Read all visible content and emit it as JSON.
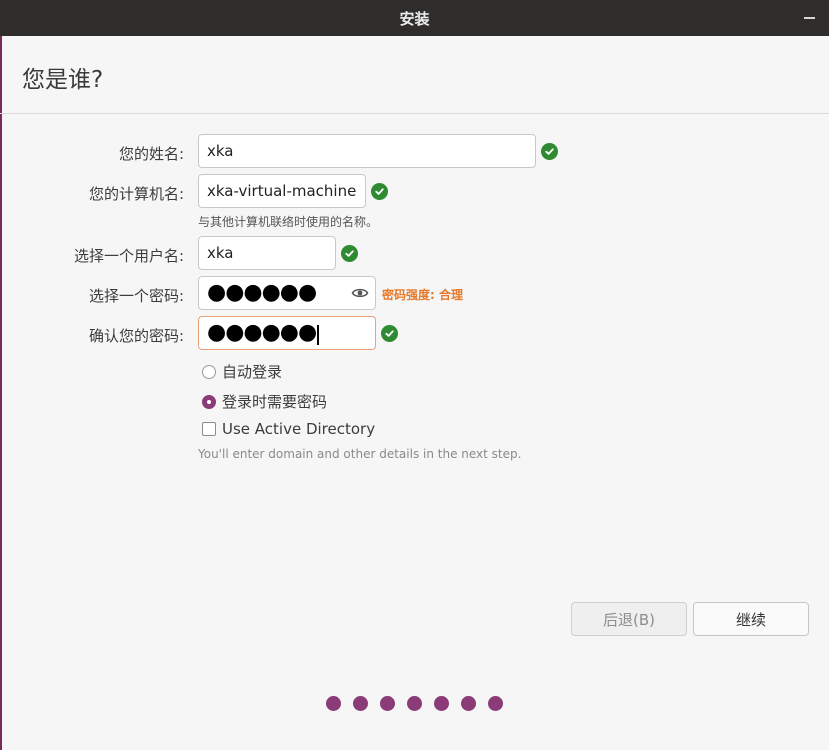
{
  "window": {
    "title": "安装"
  },
  "page": {
    "heading": "您是谁?"
  },
  "form": {
    "name_label": "您的姓名:",
    "name_value": "xka",
    "computer_label": "您的计算机名:",
    "computer_value": "xka-virtual-machine",
    "computer_hint": "与其他计算机联络时使用的名称。",
    "username_label": "选择一个用户名:",
    "username_value": "xka",
    "password_label": "选择一个密码:",
    "password_masked": "●●●●●●",
    "password_strength": "密码强度: 合理",
    "confirm_label": "确认您的密码:",
    "confirm_masked": "●●●●●●"
  },
  "login_options": {
    "auto_login": "自动登录",
    "require_password": "登录时需要密码",
    "selected": "require_password",
    "active_directory": "Use Active Directory",
    "active_directory_checked": false,
    "active_directory_note": "You'll enter domain and other details in the next step."
  },
  "buttons": {
    "back": "后退(B)",
    "continue": "继续"
  },
  "progress": {
    "steps": 7
  },
  "colors": {
    "accent": "#8a3b78",
    "ok": "#2e8b32",
    "warning": "#e7792b",
    "titlebar": "#2e2d2c"
  }
}
